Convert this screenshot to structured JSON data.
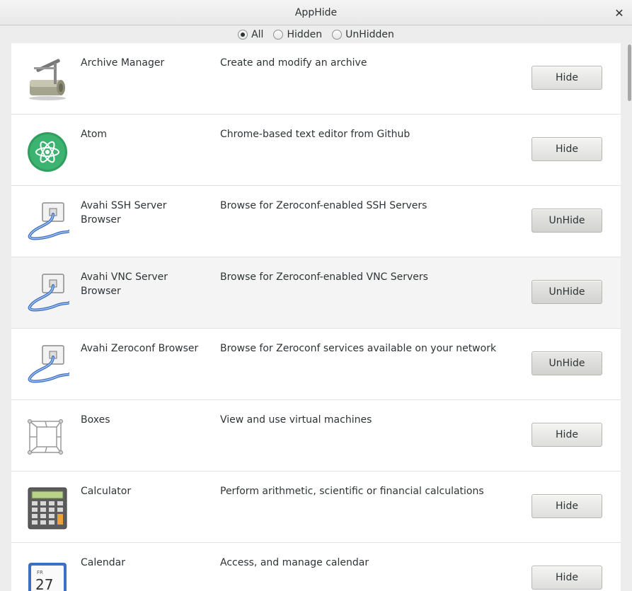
{
  "window": {
    "title": "AppHide",
    "close_glyph": "✕"
  },
  "filters": [
    {
      "label": "All",
      "checked": true
    },
    {
      "label": "Hidden",
      "checked": false
    },
    {
      "label": "UnHidden",
      "checked": false
    }
  ],
  "apps": [
    {
      "name": "Archive Manager",
      "description": "Create and modify an archive",
      "action": "Hide",
      "icon": "archive-manager-icon"
    },
    {
      "name": "Atom",
      "description": "Chrome-based text editor from Github",
      "action": "Hide",
      "icon": "atom-icon"
    },
    {
      "name": "Avahi SSH Server Browser",
      "description": "Browse for Zeroconf-enabled SSH Servers",
      "action": "UnHide",
      "icon": "network-cable-icon"
    },
    {
      "name": "Avahi VNC Server Browser",
      "description": "Browse for Zeroconf-enabled VNC Servers",
      "action": "UnHide",
      "icon": "network-cable-icon"
    },
    {
      "name": "Avahi Zeroconf Browser",
      "description": "Browse for Zeroconf services available on your network",
      "action": "UnHide",
      "icon": "network-cable-icon"
    },
    {
      "name": "Boxes",
      "description": "View and use virtual machines",
      "action": "Hide",
      "icon": "boxes-icon"
    },
    {
      "name": "Calculator",
      "description": "Perform arithmetic, scientific or financial calculations",
      "action": "Hide",
      "icon": "calculator-icon"
    },
    {
      "name": "Calendar",
      "description": "Access, and manage calendar",
      "action": "Hide",
      "icon": "calendar-icon",
      "icon_text": {
        "day": "FR",
        "date": "27"
      }
    }
  ]
}
